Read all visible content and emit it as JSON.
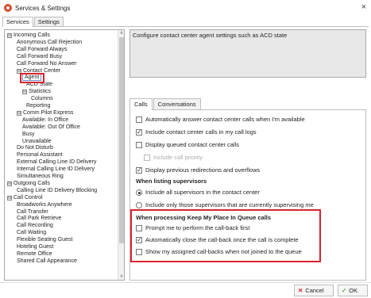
{
  "window": {
    "title": "Services & Settings",
    "close_glyph": "×"
  },
  "top_tabs": [
    {
      "label": "Services",
      "active": true
    },
    {
      "label": "Settings",
      "active": false
    }
  ],
  "tree": {
    "items": [
      {
        "label": "Incoming Calls",
        "expander": "⊟"
      },
      {
        "label": "Anonymous Call Rejection"
      },
      {
        "label": "Call Forward Always"
      },
      {
        "label": "Call Forward Busy"
      },
      {
        "label": "Call Forward No Answer"
      },
      {
        "label": "Contact Center",
        "expander": "⊟"
      },
      {
        "label": "Agent"
      },
      {
        "label": "ACD State"
      },
      {
        "label": "Statistics",
        "expander": "⊟"
      },
      {
        "label": "Columns"
      },
      {
        "label": "Reporting"
      },
      {
        "label": "Comm Pilot Express",
        "expander": "⊟"
      },
      {
        "label": "Available: In Office"
      },
      {
        "label": "Available: Out Of Office"
      },
      {
        "label": "Busy"
      },
      {
        "label": "Unavailable"
      },
      {
        "label": "Do Not Disturb"
      },
      {
        "label": "Personal Assistant"
      },
      {
        "label": "External Calling Line ID Delivery"
      },
      {
        "label": "Internal Calling Line ID Delivery"
      },
      {
        "label": "Simultaneous Ring"
      },
      {
        "label": "Outgoing Calls",
        "expander": "⊟"
      },
      {
        "label": "Calling Line ID Delivery Blocking"
      },
      {
        "label": "Call Control",
        "expander": "⊟"
      },
      {
        "label": "Broadworks Anywhere"
      },
      {
        "label": "Call Transfer"
      },
      {
        "label": "Call Park Retrieve"
      },
      {
        "label": "Call Recording"
      },
      {
        "label": "Call Waiting"
      },
      {
        "label": "Flexible Seating Guest"
      },
      {
        "label": "Hoteling Guest"
      },
      {
        "label": "Remote Office"
      },
      {
        "label": "Shared Call Appearance"
      }
    ],
    "scroll_up": "∧",
    "scroll_down": "∨"
  },
  "description": "Configure contact center agent settings such as ACD state",
  "detail_tabs": [
    {
      "label": "Calls",
      "active": true
    },
    {
      "label": "Conversations",
      "active": false
    }
  ],
  "calls": {
    "options": [
      {
        "label": "Automatically answer contact center calls when I'm available",
        "checked": false
      },
      {
        "label": "Include contact center calls in my call logs",
        "checked": true
      },
      {
        "label": "Display queued contact center calls",
        "checked": false
      },
      {
        "label": "Include call priority",
        "checked": false,
        "disabled": true
      },
      {
        "label": "Display previous redirections and overflows",
        "checked": true
      }
    ],
    "supervisors_heading": "When listing supervisors",
    "supervisors": [
      {
        "label": "Include all supervisors in the contact center",
        "checked": true
      },
      {
        "label": "Include only those supervisors that are currently supervising me",
        "checked": false
      }
    ],
    "queue_heading": "When processing Keep My Place In Queue calls",
    "queue": [
      {
        "label": "Prompt me to perform the call-back first",
        "checked": false
      },
      {
        "label": "Automatically close the call-back once the call is complete",
        "checked": true
      },
      {
        "label": "Show my assigned call-backs when not joined to the queue",
        "checked": false
      }
    ]
  },
  "buttons": {
    "cancel": {
      "label": "Cancel",
      "glyph": "✕"
    },
    "ok": {
      "label": "OK",
      "glyph": "✓"
    }
  },
  "colors": {
    "highlight_red": "#d9232f",
    "cancel_glyph": "#d9232f",
    "ok_glyph": "#5aa640"
  }
}
